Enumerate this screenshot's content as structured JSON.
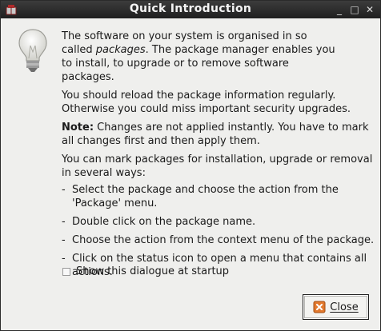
{
  "window": {
    "title": "Quick Introduction",
    "controls": {
      "minimize": "_",
      "maximize": "□",
      "close": "✕"
    }
  },
  "icons": {
    "app": "synaptic-package-icon",
    "hint": "lightbulb-icon",
    "close": "close-icon"
  },
  "content": {
    "intro": {
      "line1": "The software on your system is organised in so",
      "line2_pre": "called ",
      "line2_em": "packages",
      "line2_post": ". The package manager enables you",
      "line3": "to install, to upgrade or to remove software",
      "line4": "packages."
    },
    "reload": "You should reload the package information regularly. Otherwise you could miss important security upgrades.",
    "note": {
      "label": "Note:",
      "text": " Changes are not applied instantly. You have to mark all changes first and then apply them."
    },
    "ways_intro": "You can mark packages for installation, upgrade or removal in several ways:",
    "ways": [
      "Select the package and choose the action from the 'Package' menu.",
      "Double click on the package name.",
      "Choose the action from the context menu of the package.",
      "Click on the status icon to open a menu that contains all actions."
    ]
  },
  "checkbox": {
    "label": "Show this dialogue at startup",
    "checked": false
  },
  "buttons": {
    "close_label": "Close"
  },
  "colors": {
    "titlebar": "#2a2a2a",
    "window_bg": "#efefed",
    "close_icon": "#e2792e"
  }
}
